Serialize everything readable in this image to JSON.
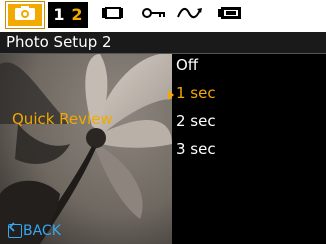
{
  "tabs": {
    "camera_icon": "camera-icon",
    "page_numbers": [
      "1",
      "2"
    ],
    "active_page": "2",
    "icons": [
      "movie-icon",
      "key-icon",
      "playback-icon",
      "battery-icon"
    ]
  },
  "header": {
    "title": "Photo Setup 2"
  },
  "setting": {
    "label": "Quick Review"
  },
  "options": [
    {
      "label": "Off",
      "selected": false
    },
    {
      "label": "1 sec",
      "selected": true
    },
    {
      "label": "2 sec",
      "selected": false
    },
    {
      "label": "3 sec",
      "selected": false
    }
  ],
  "footer": {
    "back_label": "BACK"
  },
  "colors": {
    "accent": "#f2a900",
    "back": "#37a7f0",
    "text": "#ffffff",
    "background": "#000000"
  }
}
